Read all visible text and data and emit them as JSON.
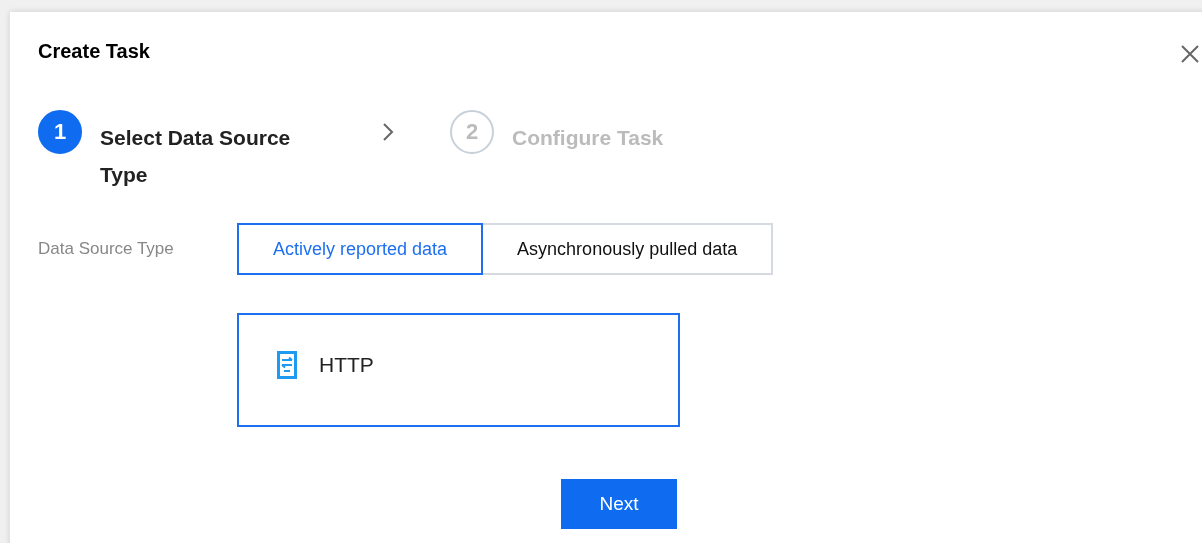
{
  "dialog": {
    "title": "Create Task"
  },
  "steps": [
    {
      "number": "1",
      "label": "Select Data Source Type",
      "selected": true
    },
    {
      "number": "2",
      "label": "Configure Task",
      "selected": false
    }
  ],
  "data_source_type": {
    "label": "Data Source Type",
    "options": [
      {
        "label": "Actively reported data",
        "selected": true
      },
      {
        "label": "Asynchronously pulled data",
        "selected": false
      }
    ]
  },
  "sources": [
    {
      "label": "HTTP",
      "selected": true
    }
  ],
  "buttons": [
    "Next"
  ]
}
